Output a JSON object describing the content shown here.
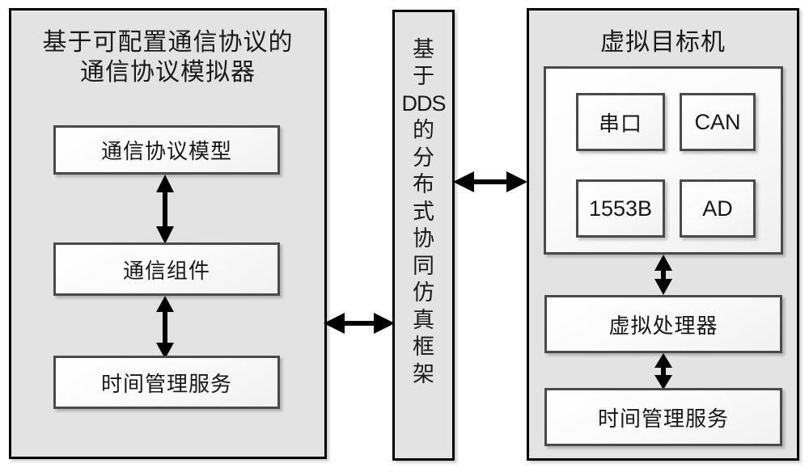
{
  "diagram": {
    "left_panel": {
      "title": "基于可配置通信协议的\n通信协议模拟器",
      "title_line1": "基于可配置通信协议的",
      "title_line2": "通信协议模拟器",
      "boxes": [
        {
          "id": "protocol-model",
          "label": "通信协议模型"
        },
        {
          "id": "comm-component",
          "label": "通信组件"
        },
        {
          "id": "time-service",
          "label": "时间管理服务"
        }
      ]
    },
    "middle_bar": {
      "label": "基于DDS的分布式协同仿真框架",
      "chars": [
        "基",
        "于",
        "DDS",
        "的",
        "分",
        "布",
        "式",
        "协",
        "同",
        "仿",
        "真",
        "框",
        "架"
      ]
    },
    "right_panel": {
      "title": "虚拟目标机",
      "interface_group": {
        "boxes": [
          {
            "id": "serial",
            "label": "串口"
          },
          {
            "id": "can",
            "label": "CAN"
          },
          {
            "id": "1553b",
            "label": "1553B"
          },
          {
            "id": "ad",
            "label": "AD"
          }
        ]
      },
      "boxes": [
        {
          "id": "virtual-processor",
          "label": "虚拟处理器"
        },
        {
          "id": "time-service",
          "label": "时间管理服务"
        }
      ]
    },
    "connectors": [
      {
        "id": "model-component",
        "kind": "double-arrow-vertical"
      },
      {
        "id": "component-time",
        "kind": "double-arrow-vertical"
      },
      {
        "id": "iface-vproc",
        "kind": "double-arrow-vertical"
      },
      {
        "id": "vproc-time",
        "kind": "double-arrow-vertical"
      },
      {
        "id": "left-middle",
        "kind": "double-arrow-horizontal"
      },
      {
        "id": "middle-right",
        "kind": "double-arrow-horizontal"
      }
    ],
    "colors": {
      "panel_fill": "#e3e3e3",
      "panel_border": "#000000",
      "box_fill": "#fbfbfb",
      "box_border": "#4a4a4a",
      "text": "#171717",
      "arrow": "#000000"
    }
  }
}
